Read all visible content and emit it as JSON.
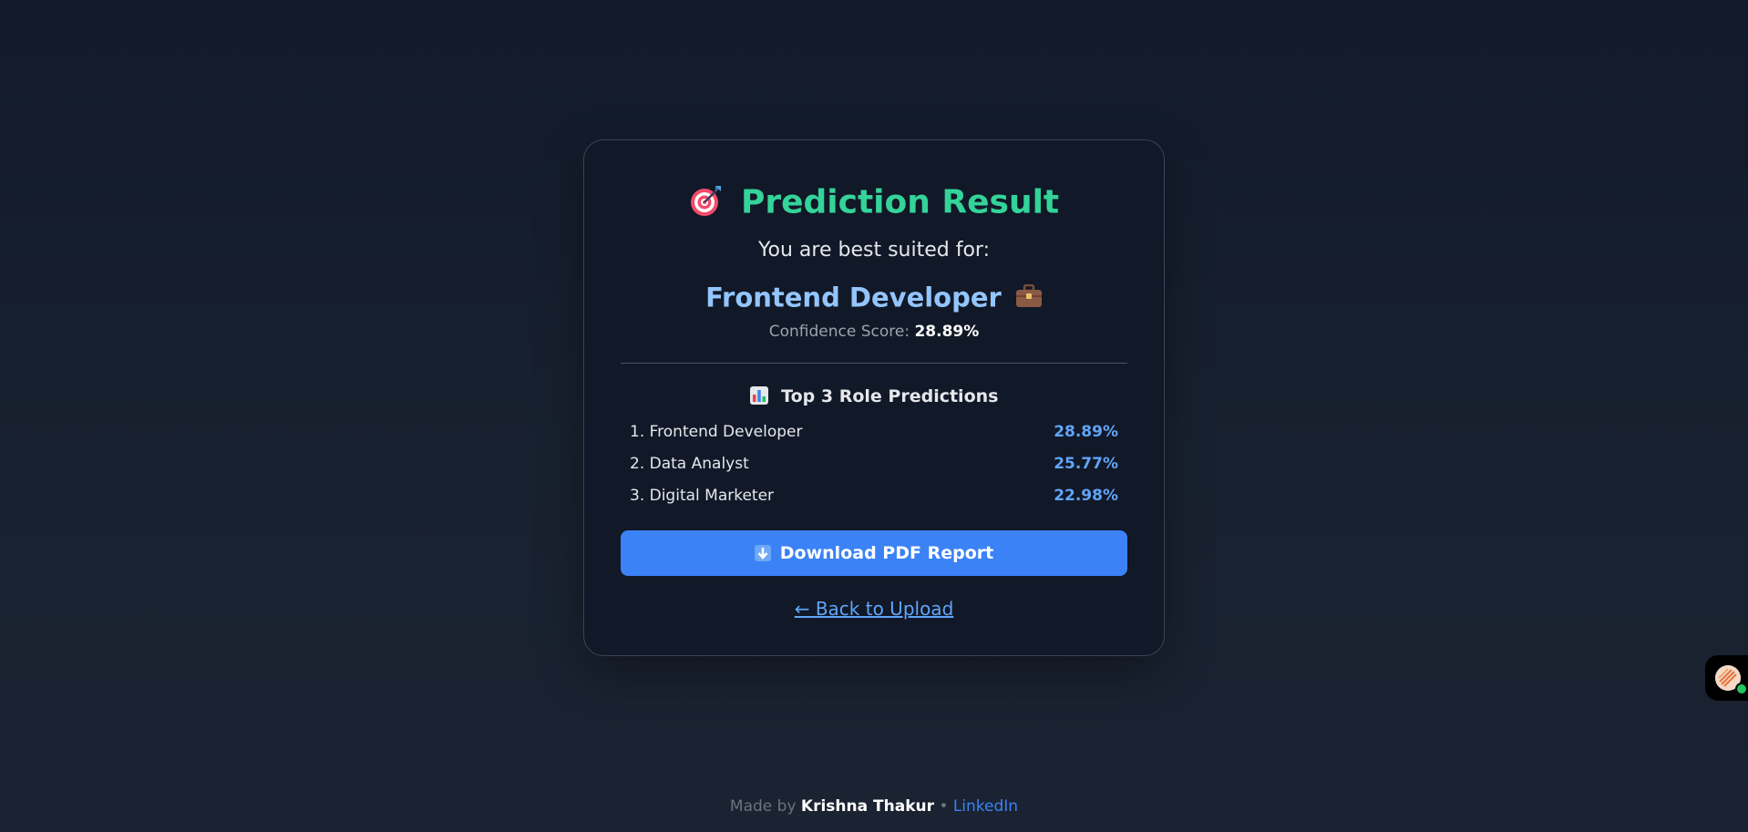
{
  "result": {
    "title": "Prediction Result",
    "title_icon": "target-icon",
    "subtitle": "You are best suited for:",
    "role": "Frontend Developer",
    "role_icon": "briefcase-icon",
    "confidence_label": "Confidence Score:",
    "confidence_value": "28.89%"
  },
  "top3": {
    "title": "Top 3 Role Predictions",
    "icon": "bar-chart-icon",
    "items": [
      {
        "rank_name": "1. Frontend Developer",
        "score": "28.89%"
      },
      {
        "rank_name": "2. Data Analyst",
        "score": "25.77%"
      },
      {
        "rank_name": "3. Digital Marketer",
        "score": "22.98%"
      }
    ]
  },
  "actions": {
    "download_label": "Download PDF Report",
    "download_icon": "download-arrow-icon",
    "back_label": "← Back to Upload"
  },
  "footer": {
    "made_by": "Made by",
    "author": "Krishna Thakur",
    "separator": "•",
    "link": "LinkedIn"
  },
  "colors": {
    "title_green": "#34d399",
    "role_blue": "#93c5fd",
    "button_blue": "#3b82f6",
    "link_blue": "#60a5fa",
    "card_bg": "#111827"
  }
}
